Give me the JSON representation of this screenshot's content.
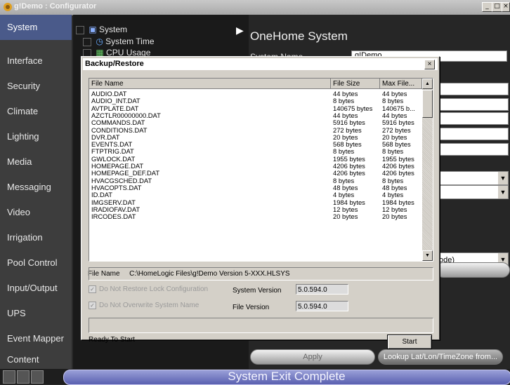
{
  "window": {
    "title": "g!Demo : Configurator",
    "min": "_",
    "max": "□",
    "close": "×"
  },
  "sidebar": {
    "items": [
      {
        "label": "System",
        "active": true
      },
      {
        "label": "Interface"
      },
      {
        "label": "Security"
      },
      {
        "label": "Climate"
      },
      {
        "label": "Lighting"
      },
      {
        "label": "Media"
      },
      {
        "label": "Messaging"
      },
      {
        "label": "Video"
      },
      {
        "label": "Irrigation"
      },
      {
        "label": "Pool Control"
      },
      {
        "label": "Input/Output"
      },
      {
        "label": "UPS"
      },
      {
        "label": "Event Mapper"
      },
      {
        "label": "Content"
      }
    ]
  },
  "tree": {
    "items": [
      "System",
      "System Time",
      "CPU Usage"
    ]
  },
  "main": {
    "title": "OneHome System",
    "system_name_label": "System Name",
    "system_name_value": "g!Demo",
    "select_value": "ode)",
    "apply_label": "Apply",
    "lookup_label": "Lookup Lat/Lon/TimeZone from..."
  },
  "dialog": {
    "title": "Backup/Restore",
    "close": "×",
    "columns": [
      "File Name",
      "File Size",
      "Max File..."
    ],
    "rows": [
      [
        "AUDIO.DAT",
        "44 bytes",
        "44 bytes"
      ],
      [
        "AUDIO_INT.DAT",
        "8 bytes",
        "8 bytes"
      ],
      [
        "AVTPLATE.DAT",
        "140675 bytes",
        "140675 b..."
      ],
      [
        "AZCTLR00000000.DAT",
        "44 bytes",
        "44 bytes"
      ],
      [
        "COMMANDS.DAT",
        "5916 bytes",
        "5916 bytes"
      ],
      [
        "CONDITIONS.DAT",
        "272 bytes",
        "272 bytes"
      ],
      [
        "DVR.DAT",
        "20 bytes",
        "20 bytes"
      ],
      [
        "EVENTS.DAT",
        "568 bytes",
        "568 bytes"
      ],
      [
        "FTPTRIG.DAT",
        "8 bytes",
        "8 bytes"
      ],
      [
        "GWLOCK.DAT",
        "1955 bytes",
        "1955 bytes"
      ],
      [
        "HOMEPAGE.DAT",
        "4206 bytes",
        "4206 bytes"
      ],
      [
        "HOMEPAGE_DEF.DAT",
        "4206 bytes",
        "4206 bytes"
      ],
      [
        "HVACGSCHED.DAT",
        "8 bytes",
        "8 bytes"
      ],
      [
        "HVACOPTS.DAT",
        "48 bytes",
        "48 bytes"
      ],
      [
        "ID.DAT",
        "4 bytes",
        "4 bytes"
      ],
      [
        "IMGSERV.DAT",
        "1984 bytes",
        "1984 bytes"
      ],
      [
        "IRADIOFAV.DAT",
        "12 bytes",
        "12 bytes"
      ],
      [
        "IRCODES.DAT",
        "20 bytes",
        "20 bytes"
      ]
    ],
    "file_name_label": "File Name",
    "file_name_value": "C:\\HomeLogic Files\\g!Demo Version 5-XXX.HLSYS",
    "opt_lock": "Do Not Restore Lock Configuration",
    "opt_name": "Do Not Overwrite System Name",
    "system_version_label": "System Version",
    "system_version_value": "5.0.594.0",
    "file_version_label": "File Version",
    "file_version_value": "5.0.594.0",
    "status": "Ready To Start",
    "start_label": "Start"
  },
  "statusbar": {
    "message": "System Exit Complete"
  },
  "colors": {
    "accent": "#4a5a8a",
    "status_track": "#7a80c8"
  }
}
